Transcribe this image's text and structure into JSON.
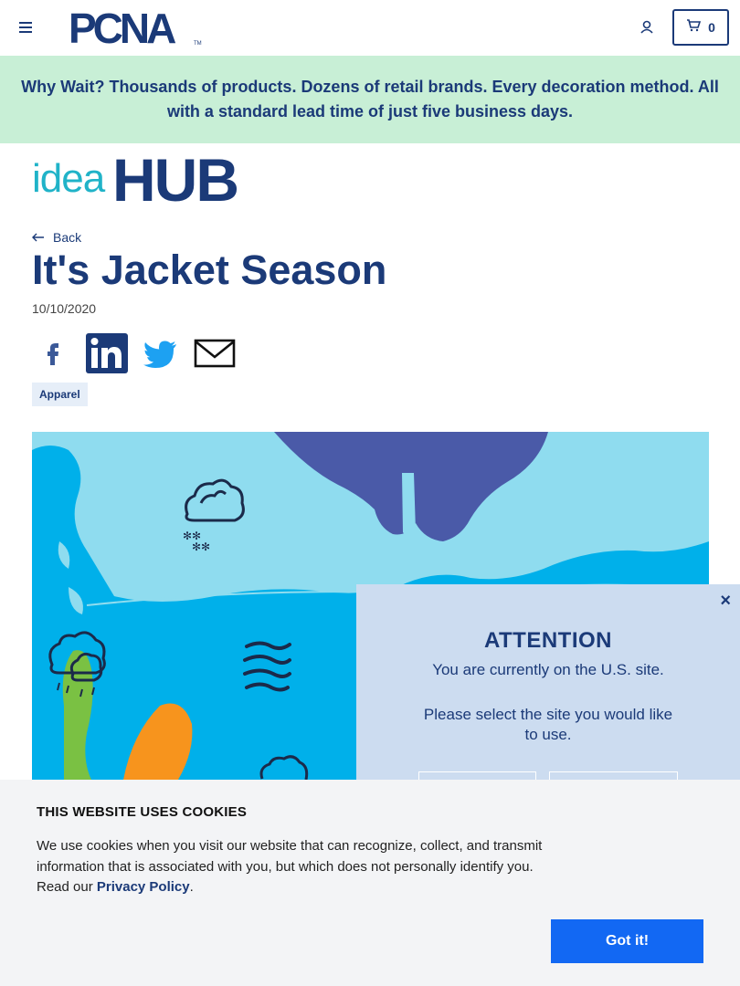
{
  "header": {
    "brand": "PCNA",
    "cart_count": "0",
    "menu_icon": "hamburger-menu-icon",
    "account_icon": "user-icon",
    "cart_icon": "shopping-cart-icon"
  },
  "promo": {
    "text": "Why Wait? Thousands of products. Dozens of retail brands. Every decoration method. All with a standard lead time of just five business days."
  },
  "idea_hub": {
    "idea": "idea",
    "hub": "HUB"
  },
  "article": {
    "back_label": "Back",
    "title": "It's Jacket Season",
    "date": "10/10/2020",
    "tag": "Apparel",
    "share_icons": [
      "facebook-icon",
      "linkedin-icon",
      "twitter-icon",
      "email-icon"
    ]
  },
  "attention": {
    "close": "×",
    "title": "ATTENTION",
    "line1": "You are currently on the U.S. site.",
    "line2": "Please select the site you would like to use."
  },
  "cookie": {
    "title": "THIS WEBSITE USES COOKIES",
    "text_before": "We use cookies when you visit our website that can recognize, collect, and transmit information that is associated with you, but which does not personally identify you. Read our ",
    "link": "Privacy Policy",
    "text_after": ".",
    "button": "Got it!"
  },
  "colors": {
    "navy": "#1b3a78",
    "teal": "#20b3c8",
    "promo_bg": "#c8efd6",
    "map_ocean": "#00b0ea",
    "modal_bg": "#ccdcf0",
    "cookie_button": "#1268f3"
  }
}
